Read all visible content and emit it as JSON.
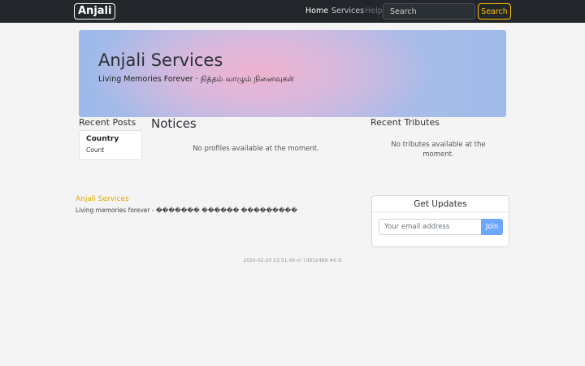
{
  "nav": {
    "brand": "Anjali",
    "links": [
      "Home",
      "Services",
      "Help"
    ],
    "search_placeholder": "Search",
    "search_button": "Search"
  },
  "hero": {
    "title": "Anjali Services",
    "subtitle": "Living Memories Forever · நித்தம் வாழும் நினைவுகள்"
  },
  "recent_posts": {
    "title": "Recent Posts",
    "items": [
      {
        "label": "Country",
        "sublabel": "Count"
      }
    ]
  },
  "notices": {
    "title": "Notices",
    "empty_text": "No profiles available at the moment."
  },
  "recent_tributes": {
    "title": "Recent Tributes",
    "empty_text": "No tributes available at the moment."
  },
  "footer": {
    "brand": "Anjali Services",
    "tagline": "Living memories forever - ������� ������ ���������"
  },
  "updates": {
    "title": "Get Updates",
    "email_placeholder": "Your email address",
    "join_button": "Join"
  },
  "build_info": "2026-02-20 23:51:49 m 7d932489 #6 D",
  "colors": {
    "navbar_bg": "#23272b",
    "accent_warning": "#ffc107",
    "join_button": "#6ea8fe",
    "footer_brand": "#e0a800"
  }
}
